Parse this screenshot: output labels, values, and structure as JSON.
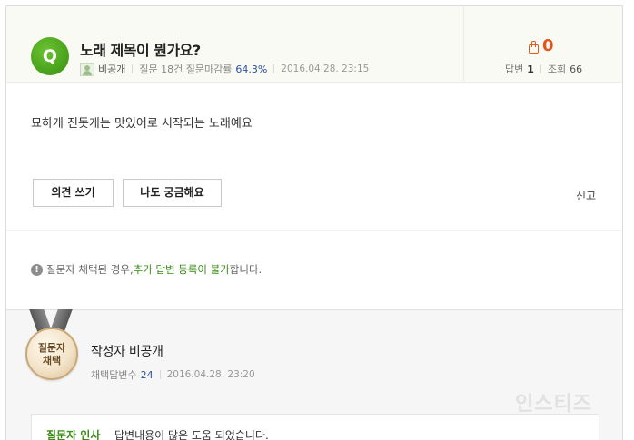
{
  "question": {
    "badge": "Q",
    "title": "노래 제목이 뭔가요?",
    "author": "비공개",
    "stats_text": "질문 18건 질문마감률",
    "close_rate": "64.3%",
    "date": "2016.04.28. 23:15",
    "likes": "0",
    "answers_label": "답변",
    "answers_count": "1",
    "views_label": "조회",
    "views_count": "66",
    "body": "묘하게 진돗개는 맛있어로 시작되는 노래예요"
  },
  "actions": {
    "opinion_button": "의견 쓰기",
    "curious_button": "나도 궁금해요",
    "report": "신고"
  },
  "notice": {
    "icon": "!",
    "prefix": "질문자 채택된 경우, ",
    "highlight": "추가 답변 등록이 불가",
    "suffix": "합니다."
  },
  "answer": {
    "medal_line1": "질문자",
    "medal_line2": "채택",
    "author": "작성자 비공개",
    "adopted_label": "채택답변수",
    "adopted_count": "24",
    "date": "2016.04.28. 23:20",
    "thanks_label": "질문자 인사",
    "thanks_text": "답변내용이 많은 도움 되었습니다."
  },
  "watermark": "인스티즈",
  "colors": {
    "q_badge": "#4aa41c",
    "likes": "#e2561b",
    "highlight_green": "#3b8a17",
    "rate_blue": "#2c4f9a"
  }
}
